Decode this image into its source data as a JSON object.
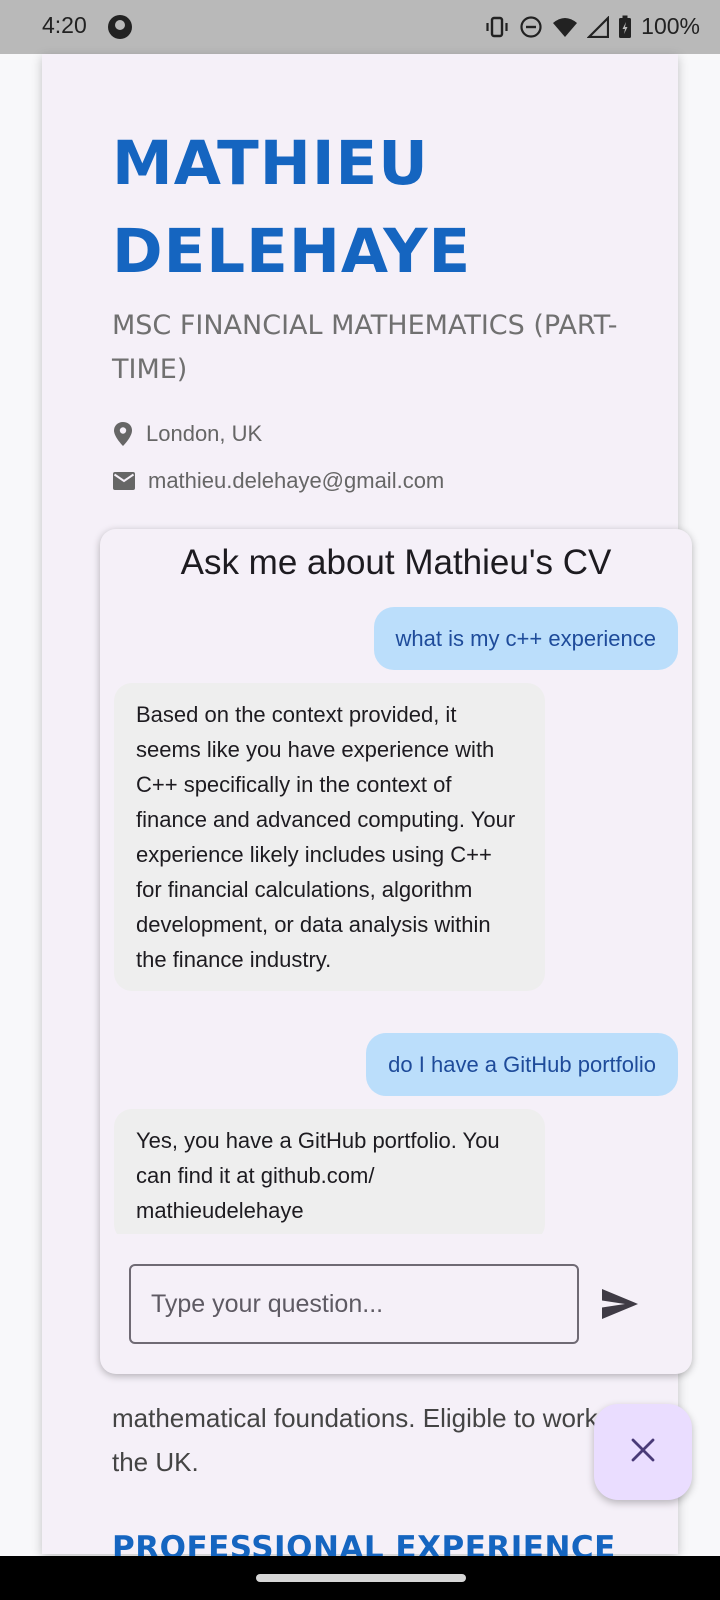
{
  "status_bar": {
    "time": "4:20",
    "battery": "100%",
    "icons": [
      "app-notification-icon",
      "vibrate-icon",
      "do-not-disturb-icon",
      "wifi-icon",
      "signal-icon",
      "battery-charging-icon"
    ]
  },
  "cv": {
    "name": "MATHIEU DELEHAYE",
    "subtitle": "MSC FINANCIAL MATHEMATICS (PART-TIME)",
    "location": "London, UK",
    "email": "mathieu.delehaye@gmail.com",
    "summary_visible": "mathematical foundations. Eligible to work in the UK.",
    "section_heading": "PROFESSIONAL EXPERIENCE",
    "accent_color": "#1565c0"
  },
  "chat": {
    "title": "Ask me about Mathieu's CV",
    "messages": [
      {
        "role": "user",
        "text": "what is my c++ experience"
      },
      {
        "role": "bot",
        "text": "Based on the context provided, it seems like you have experience with C++ specifically in the context of finance and advanced computing. Your experience likely includes using C++ for financial calculations, algorithm development, or data analysis within the finance industry."
      },
      {
        "role": "user",
        "text": "do I have a GitHub portfolio"
      },
      {
        "role": "bot",
        "text": "Yes, you have a GitHub portfolio. You can find it at github.com/ mathieudelehaye"
      }
    ],
    "input_placeholder": "Type your question...",
    "user_bubble_color": "#bbdefb",
    "bot_bubble_color": "#eeeeee"
  },
  "fab": {
    "icon": "close-icon",
    "color": "#eaddff"
  }
}
